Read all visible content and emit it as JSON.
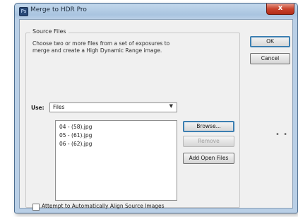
{
  "window": {
    "title": "Merge to HDR Pro",
    "close_glyph": "x",
    "app_icon_glyph": "Ps"
  },
  "source_files": {
    "legend": "Source Files",
    "description_line1": "Choose two or more files from a set of exposures to",
    "description_line2": "merge and create a High Dynamic Range image.",
    "use_label": "Use:",
    "use_value": "Files",
    "files": [
      "04 - (58).jpg",
      "05 - (61).jpg",
      "06 - (62).jpg"
    ],
    "browse_label": "Browse...",
    "remove_label": "Remove",
    "add_open_label": "Add Open Files",
    "align_label": "Attempt to Automatically Align Source Images"
  },
  "buttons": {
    "ok_label": "OK",
    "cancel_label": "Cancel"
  },
  "icons": {
    "dropdown": "chevron-down-icon",
    "close": "close-icon"
  }
}
